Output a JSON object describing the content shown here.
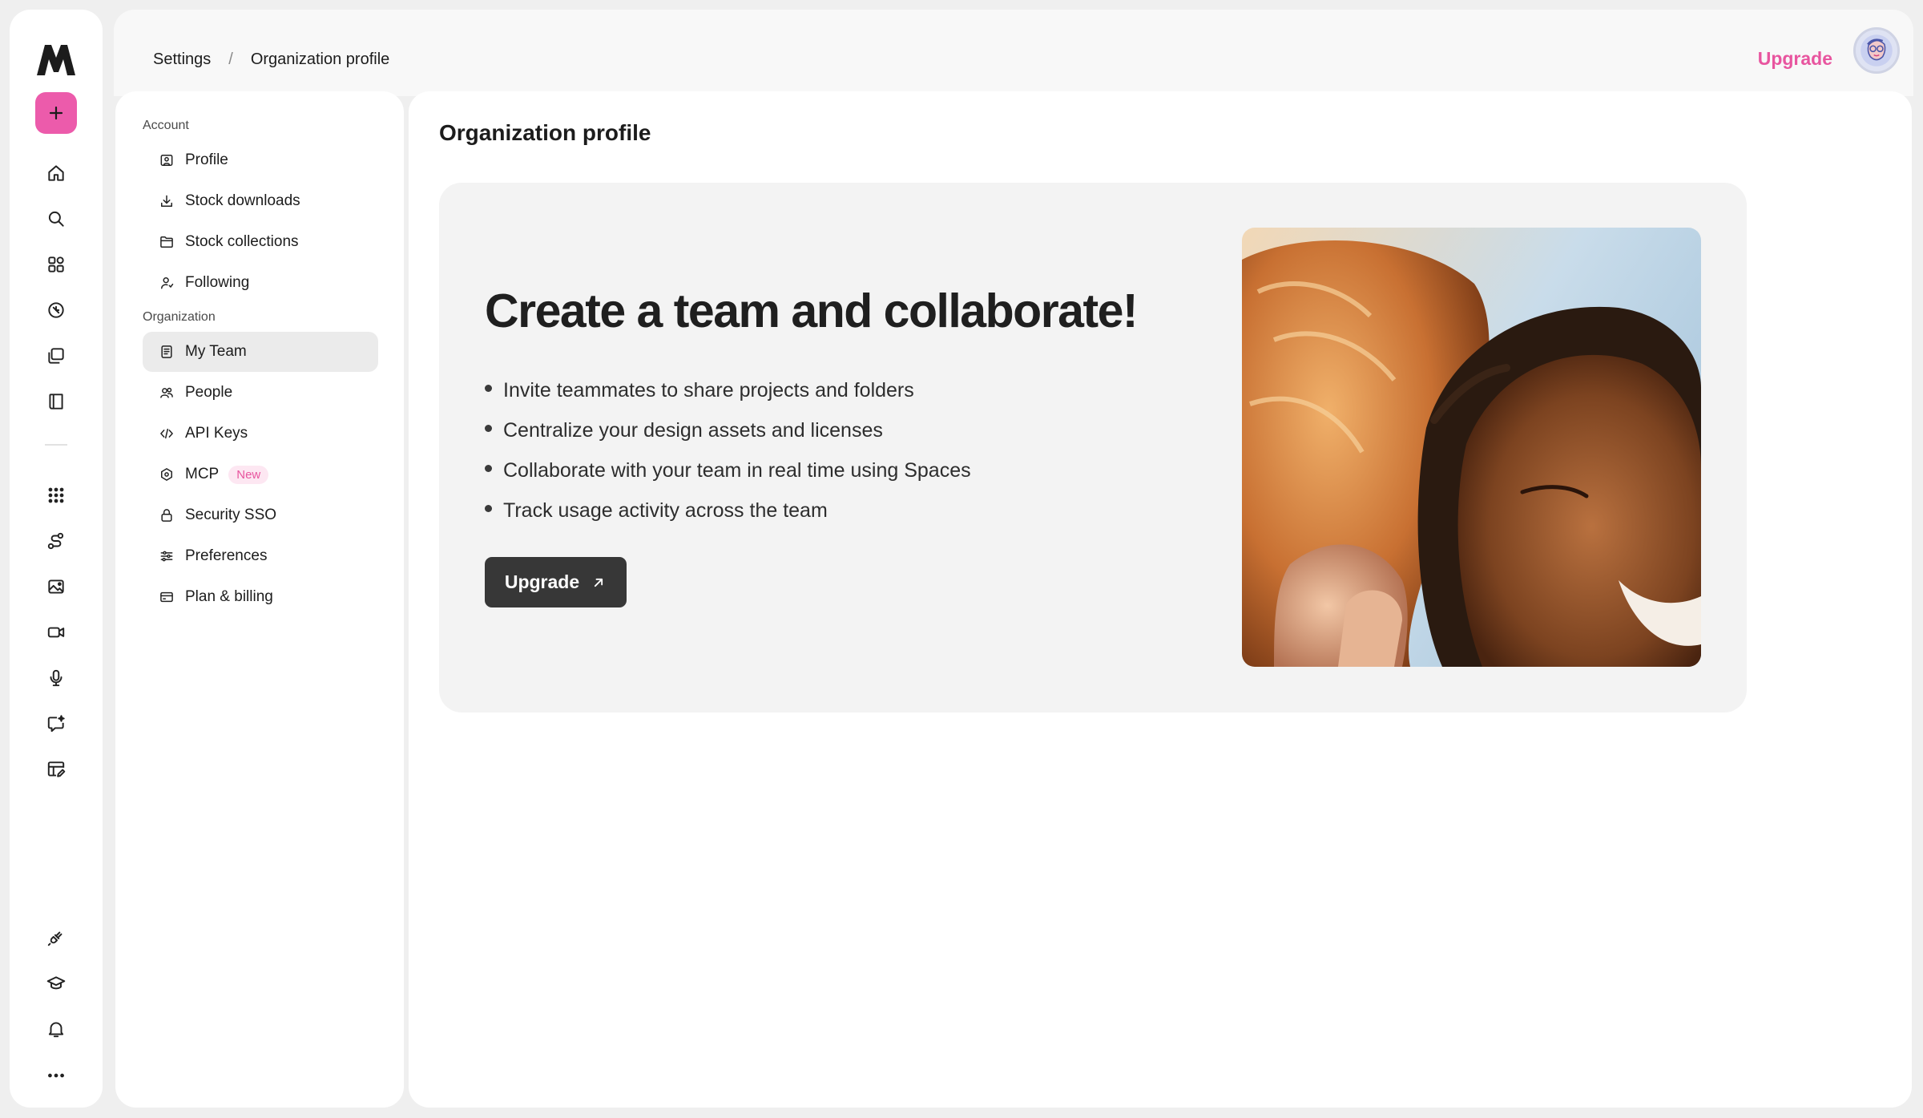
{
  "breadcrumb": {
    "root": "Settings",
    "separator": "/",
    "current": "Organization profile"
  },
  "header": {
    "upgrade_label": "Upgrade"
  },
  "rail": {
    "icons": [
      "home-icon",
      "search-icon",
      "apps-icon",
      "compass-icon",
      "collections-icon",
      "book-icon",
      "grid-icon",
      "workflow-icon",
      "image-edit-icon",
      "video-icon",
      "mic-icon",
      "chat-sparkle-icon",
      "template-edit-icon",
      "plugin-icon",
      "learn-icon",
      "bell-icon",
      "more-icon"
    ],
    "accent": "#ec5bab"
  },
  "subnav": {
    "account_label": "Account",
    "account_items": [
      {
        "label": "Profile",
        "icon": "profile-icon"
      },
      {
        "label": "Stock downloads",
        "icon": "download-icon"
      },
      {
        "label": "Stock collections",
        "icon": "folder-icon"
      },
      {
        "label": "Following",
        "icon": "user-follow-icon"
      }
    ],
    "organization_label": "Organization",
    "organization_items": [
      {
        "label": "My Team",
        "icon": "team-doc-icon",
        "active": true
      },
      {
        "label": "People",
        "icon": "people-icon"
      },
      {
        "label": "API Keys",
        "icon": "code-icon"
      },
      {
        "label": "MCP",
        "icon": "mcp-icon",
        "badge": "New"
      },
      {
        "label": "Security SSO",
        "icon": "lock-icon"
      },
      {
        "label": "Preferences",
        "icon": "sliders-icon"
      },
      {
        "label": "Plan & billing",
        "icon": "card-icon"
      }
    ]
  },
  "main": {
    "title": "Organization profile",
    "promo": {
      "heading": "Create a team and collaborate!",
      "bullets": [
        "Invite teammates to share projects and folders",
        "Centralize your design assets and licenses",
        "Collaborate with your team in real time using Spaces",
        "Track usage activity across the team"
      ],
      "cta_label": "Upgrade"
    }
  },
  "colors": {
    "brand_pink": "#e8559f",
    "cta_bg": "#373737",
    "promo_bg": "#f3f3f3"
  }
}
